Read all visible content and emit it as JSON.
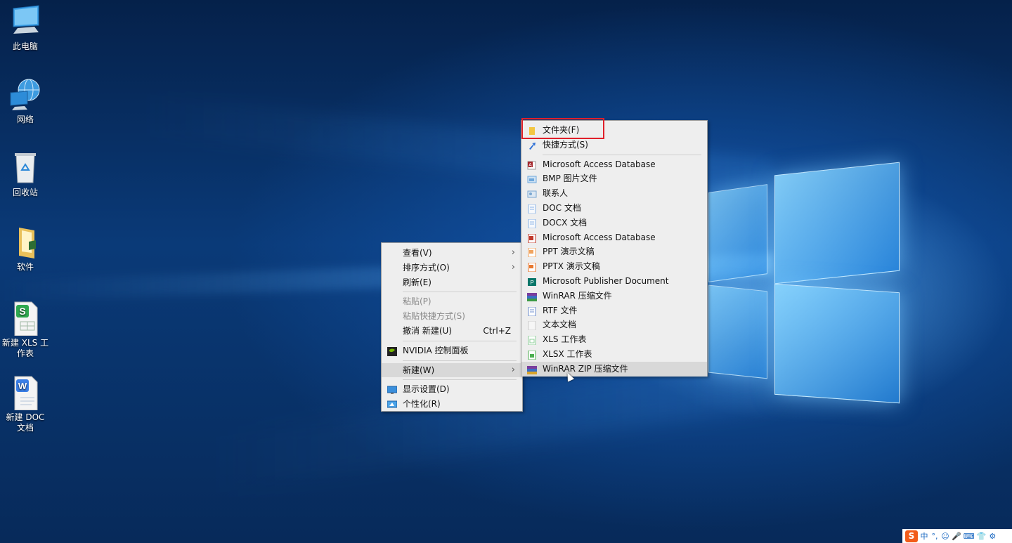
{
  "desktop": {
    "icons": [
      {
        "label": "此电脑",
        "icon": "computer-icon"
      },
      {
        "label": "网络",
        "icon": "network-icon"
      },
      {
        "label": "回收站",
        "icon": "recycle-bin-icon"
      },
      {
        "label": "软件",
        "icon": "folder-icon"
      },
      {
        "label": "新建 XLS 工作表",
        "icon": "xls-file-icon"
      },
      {
        "label": "新建 DOC 文档",
        "icon": "doc-file-icon"
      }
    ]
  },
  "context_menu": {
    "items": [
      {
        "label": "查看(V)",
        "submenu": true
      },
      {
        "label": "排序方式(O)",
        "submenu": true
      },
      {
        "label": "刷新(E)"
      },
      {
        "label": "粘贴(P)",
        "disabled": true
      },
      {
        "label": "粘贴快捷方式(S)",
        "disabled": true
      },
      {
        "label": "撤消 新建(U)",
        "shortcut": "Ctrl+Z"
      },
      {
        "label": "NVIDIA 控制面板",
        "icon": "nvidia-icon"
      },
      {
        "label": "新建(W)",
        "submenu": true,
        "active": true
      },
      {
        "label": "显示设置(D)",
        "icon": "display-icon"
      },
      {
        "label": "个性化(R)",
        "icon": "personalize-icon"
      }
    ]
  },
  "new_submenu": {
    "items": [
      {
        "label": "文件夹(F)",
        "icon": "folder-icon",
        "color": "#f3c742"
      },
      {
        "label": "快捷方式(S)",
        "icon": "shortcut-icon",
        "color": "#2d6fd6"
      },
      {
        "label": "Microsoft Access Database",
        "icon": "access-icon",
        "color": "#a4262c"
      },
      {
        "label": "BMP 图片文件",
        "icon": "bmp-icon",
        "color": "#6fa8dc"
      },
      {
        "label": "联系人",
        "icon": "contact-icon",
        "color": "#7ba7d1"
      },
      {
        "label": "DOC 文档",
        "icon": "doc-icon",
        "color": "#8bb4e7"
      },
      {
        "label": "DOCX 文档",
        "icon": "docx-icon",
        "color": "#8bb4e7"
      },
      {
        "label": "Microsoft Access Database",
        "icon": "access-icon",
        "color": "#c0392b"
      },
      {
        "label": "PPT 演示文稿",
        "icon": "ppt-icon",
        "color": "#f0a35e"
      },
      {
        "label": "PPTX 演示文稿",
        "icon": "pptx-icon",
        "color": "#e8772e"
      },
      {
        "label": "Microsoft Publisher Document",
        "icon": "publisher-icon",
        "color": "#077568"
      },
      {
        "label": "WinRAR 压缩文件",
        "icon": "winrar-icon",
        "color": "#7a3e9d"
      },
      {
        "label": "RTF 文件",
        "icon": "rtf-icon",
        "color": "#6f8fcf"
      },
      {
        "label": "文本文档",
        "icon": "text-icon",
        "color": "#cccccc"
      },
      {
        "label": "XLS 工作表",
        "icon": "xls-icon",
        "color": "#8fcf9b"
      },
      {
        "label": "XLSX 工作表",
        "icon": "xlsx-icon",
        "color": "#4caf50"
      },
      {
        "label": "WinRAR ZIP 压缩文件",
        "icon": "winrar-zip-icon",
        "color": "#7a3e9d",
        "active": true
      }
    ]
  },
  "tray": {
    "ime_logo": "S",
    "ime_mode": "中",
    "items": [
      "°,",
      "☺",
      "🎤",
      "⌨",
      "👕",
      "⚙"
    ]
  },
  "colors": {
    "highlight": "#e0202a",
    "menu_bg": "#eeeeee"
  }
}
